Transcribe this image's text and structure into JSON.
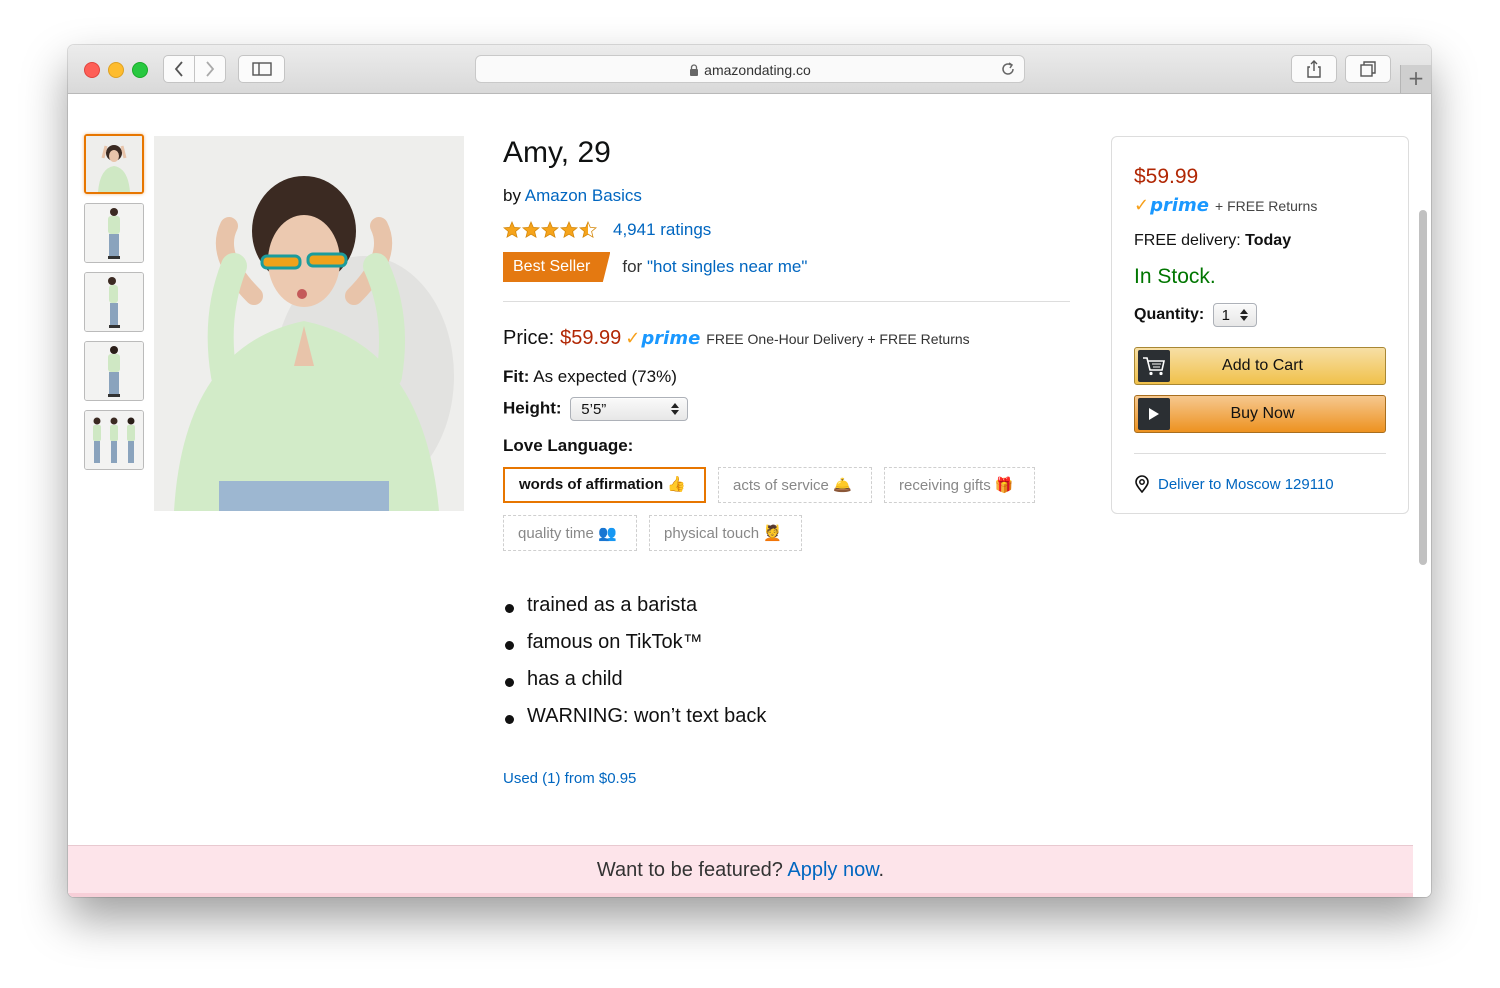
{
  "browser": {
    "url": "amazondating.co",
    "new_tab_symbol": "+"
  },
  "product": {
    "title": "Amy, 29",
    "by_prefix": "by",
    "brand": "Amazon Basics",
    "rating_stars": 4.5,
    "ratings_text": "4,941 ratings",
    "best_seller_label": "Best Seller",
    "best_for_prefix": "for",
    "best_for_query": "\"hot singles near me\"",
    "price_label": "Price:",
    "price": "$59.99",
    "prime_label": "prime",
    "price_note": "FREE One-Hour Delivery + FREE Returns",
    "fit_label": "Fit:",
    "fit_value": "As expected (73%)",
    "height_label": "Height:",
    "height_value": "5’5”",
    "love_language_label": "Love Language:",
    "love_languages": [
      {
        "label": "words of affirmation",
        "emoji": "👍",
        "selected": true
      },
      {
        "label": "acts of service",
        "emoji": "🛎️",
        "selected": false
      },
      {
        "label": "receiving gifts",
        "emoji": "🎁",
        "selected": false
      },
      {
        "label": "quality time",
        "emoji": "👥",
        "selected": false
      },
      {
        "label": "physical touch",
        "emoji": "💆",
        "selected": false
      }
    ],
    "bullets": [
      "trained as a barista",
      "famous on TikTok™",
      "has a child",
      "WARNING: won’t text back"
    ],
    "used_offer": "Used (1) from $0.95"
  },
  "buybox": {
    "price": "$59.99",
    "prime_label": "prime",
    "returns": "+ FREE Returns",
    "delivery_label": "FREE delivery:",
    "delivery_value": "Today",
    "stock": "In Stock.",
    "quantity_label": "Quantity:",
    "quantity_value": "1",
    "add_to_cart": "Add to Cart",
    "buy_now": "Buy Now",
    "deliver_to": "Deliver to Moscow 129110"
  },
  "banner": {
    "text": "Want to be featured?",
    "link": "Apply now",
    "suffix": "."
  },
  "colors": {
    "accent_orange": "#e77600",
    "link_blue": "#0066c0",
    "price_red": "#b12704",
    "stock_green": "#007600",
    "banner_pink": "#fde4ea"
  }
}
